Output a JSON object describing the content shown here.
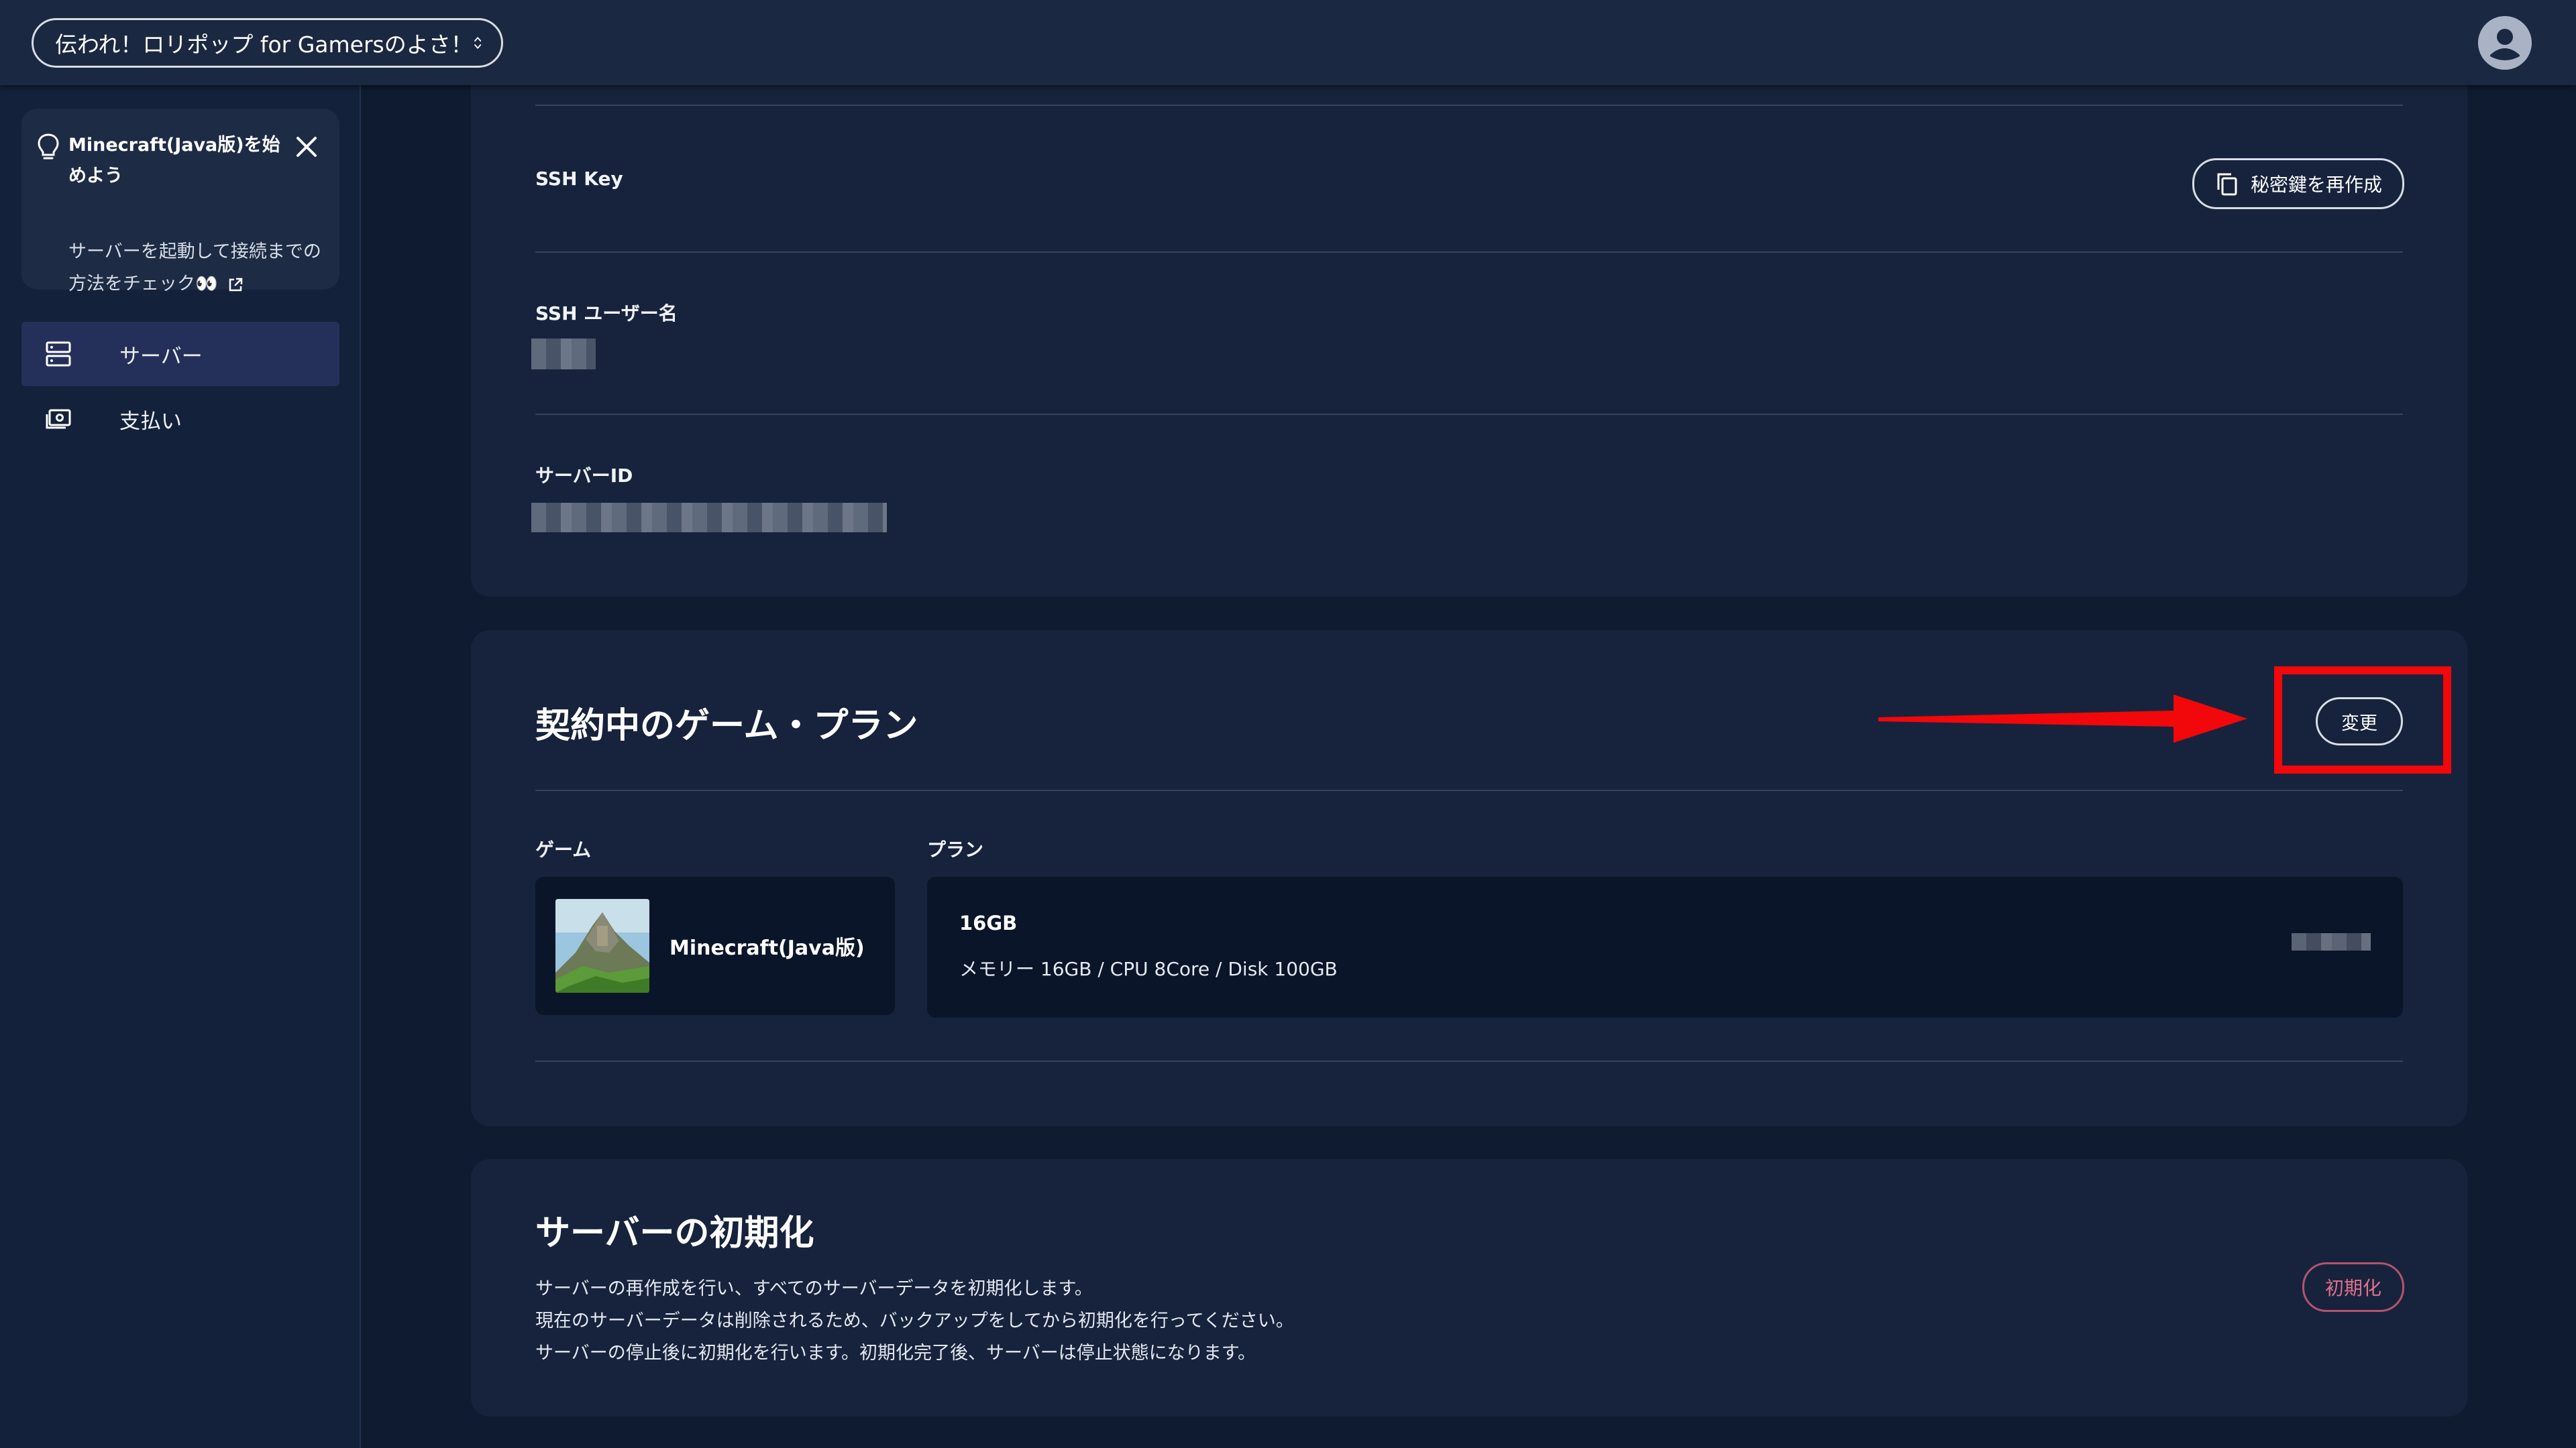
{
  "topbar": {
    "server_name": "伝われ！ロリポップ for Gamersのよさ！",
    "selector_icon": "chevron-up-down-icon",
    "avatar_icon": "user-avatar-icon"
  },
  "sidebar": {
    "tip": {
      "icon": "lightbulb-icon",
      "title": "Minecraft(Java版)を始めよう",
      "body": "サーバーを起動して接続までの方法をチェック👀",
      "close_icon": "close-icon",
      "link_icon": "external-link-icon"
    },
    "items": [
      {
        "label": "サーバー",
        "icon": "server-icon",
        "active": true
      },
      {
        "label": "支払い",
        "icon": "payment-icon",
        "active": false
      }
    ]
  },
  "server_info": {
    "ssh_key": {
      "label": "SSH Key",
      "button_label": "秘密鍵を再作成",
      "button_icon": "copy-icon"
    },
    "ssh_user": {
      "label": "SSH ユーザー名"
    },
    "server_id": {
      "label": "サーバーID"
    }
  },
  "plan_section": {
    "title": "契約中のゲーム・プラン",
    "change_button": "変更",
    "game_label": "ゲーム",
    "plan_label": "プラン",
    "game_name": "Minecraft(Java版)",
    "plan_name": "16GB",
    "plan_desc": "メモリー 16GB / CPU 8Core / Disk 100GB"
  },
  "reset_section": {
    "title": "サーバーの初期化",
    "lines": [
      "サーバーの再作成を行い、すべてのサーバーデータを初期化します。",
      "現在のサーバーデータは削除されるため、バックアップをしてから初期化を行ってください。",
      "サーバーの停止後に初期化を行います。初期化完了後、サーバーは停止状態になります。"
    ],
    "button": "初期化"
  },
  "colors": {
    "background": "#0f1b31",
    "card": "#17233c",
    "annotation": "#f2070b",
    "danger": "#e0708e"
  }
}
